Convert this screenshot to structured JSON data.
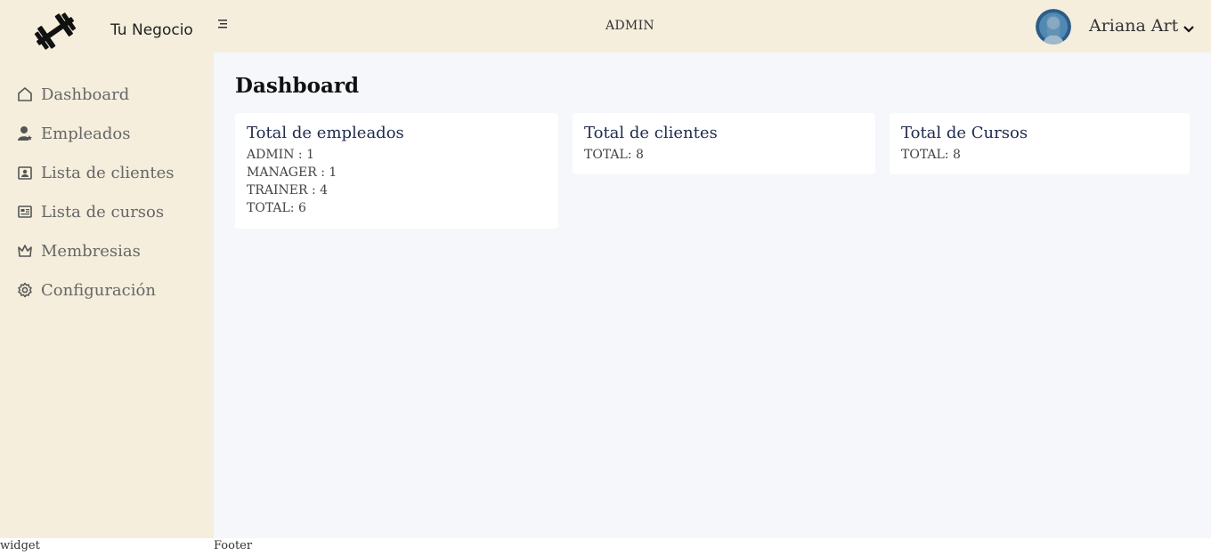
{
  "header": {
    "brand": "Tu Negocio",
    "role": "ADMIN",
    "user_name": "Ariana Art",
    "logo_icon": "dumbbell-icon",
    "menu_icon": "menu-icon",
    "chevron_icon": "chevron-down-icon"
  },
  "sidebar": {
    "items": [
      {
        "label": "Dashboard",
        "icon": "home-icon"
      },
      {
        "label": "Empleados",
        "icon": "user-star-icon"
      },
      {
        "label": "Lista de clientes",
        "icon": "contact-card-icon"
      },
      {
        "label": "Lista de cursos",
        "icon": "newspaper-icon"
      },
      {
        "label": "Membresias",
        "icon": "crown-icon"
      },
      {
        "label": "Configuración",
        "icon": "gear-icon"
      }
    ]
  },
  "main": {
    "title": "Dashboard",
    "cards": [
      {
        "title": "Total de empleados",
        "lines": [
          "ADMIN : 1",
          "MANAGER : 1",
          "TRAINER : 4",
          "TOTAL: 6"
        ]
      },
      {
        "title": "Total de clientes",
        "lines": [
          "TOTAL: 8"
        ]
      },
      {
        "title": "Total de Cursos",
        "lines": [
          "TOTAL: 8"
        ]
      }
    ]
  },
  "footer": {
    "widget": "widget",
    "text": "Footer"
  },
  "colors": {
    "sidebar_bg": "#f5eedd",
    "main_bg": "#f5f7fb",
    "card_title": "#1f2a4d"
  }
}
